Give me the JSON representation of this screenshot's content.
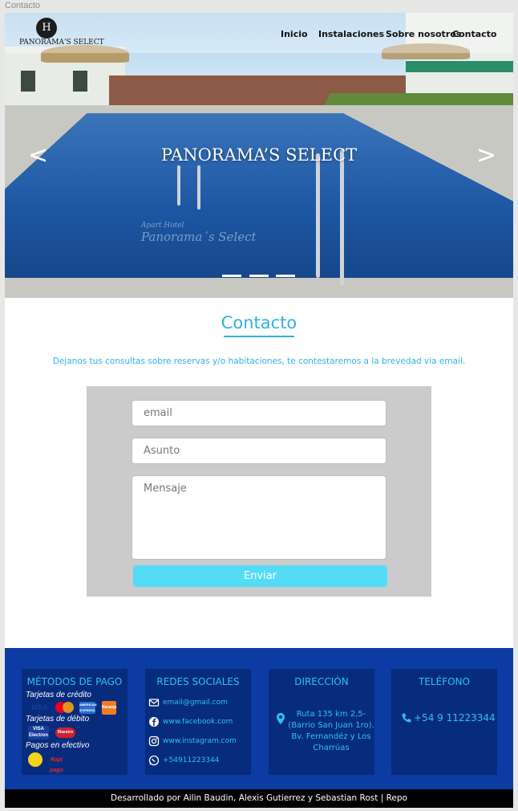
{
  "window": {
    "title": "Contacto"
  },
  "brand": {
    "logo_monogram": "H",
    "logo_text": "PANORAMA'S SELECT"
  },
  "nav": {
    "items": [
      {
        "label": "Inicio"
      },
      {
        "label": "Instalaciones"
      },
      {
        "label": "Sobre nosotros"
      },
      {
        "label": "Contacto"
      }
    ]
  },
  "hero": {
    "title": "PANORAMA’S SELECT",
    "prev_arrow": "<",
    "next_arrow": ">",
    "slides_count": 3,
    "pool_sign": "Panorama´s Select",
    "pool_sign_small": "Apart Hotel"
  },
  "contact": {
    "title": "Contacto",
    "intro": "Dejanos tus consultas sobre reservas y/o habitaciones, te contestaremos a la brevedad via email.",
    "form": {
      "email_placeholder": "email",
      "subject_placeholder": "Asunto",
      "message_placeholder": "Mensaje",
      "submit_label": "Enviar"
    }
  },
  "footer": {
    "payment": {
      "title": "MÉTODOS DE PAGO",
      "credit_label": "Tarjetas de crédito",
      "debit_label": "Tarjetas de débito",
      "cash_label": "Pagos en efectivo",
      "credit_logos": [
        "VISA",
        "mastercard-logo",
        "AMERICAN EXPRESS",
        "Naranja"
      ],
      "debit_logos": [
        "VISA Electron",
        "Maestro"
      ],
      "cash_logos": [
        "pago-facil-logo",
        "Rapi pago"
      ]
    },
    "social": {
      "title": "REDES SOCIALES",
      "email": "email@gmail.com",
      "facebook": "www.facebook.com",
      "instagram": "www.instagram.com",
      "whatsapp": "+54911223344"
    },
    "address": {
      "title": "DIRECCIÓN",
      "text": "Ruta 135 km 2,5- (Barrio San Juan 1ro). Bv. Fernandéz y Los Charrúas"
    },
    "phone": {
      "title": "TELÉFONO",
      "number": "+54 9 11223344"
    },
    "credits": "Desarrollado por Ailin Baudin, Alexis Gutierrez y Sebastian Rost | Repo"
  },
  "colors": {
    "accent": "#2fb3e6",
    "button": "#54dcf7",
    "footer_bg": "#0b3ba3",
    "card_bg": "#082c7d"
  }
}
